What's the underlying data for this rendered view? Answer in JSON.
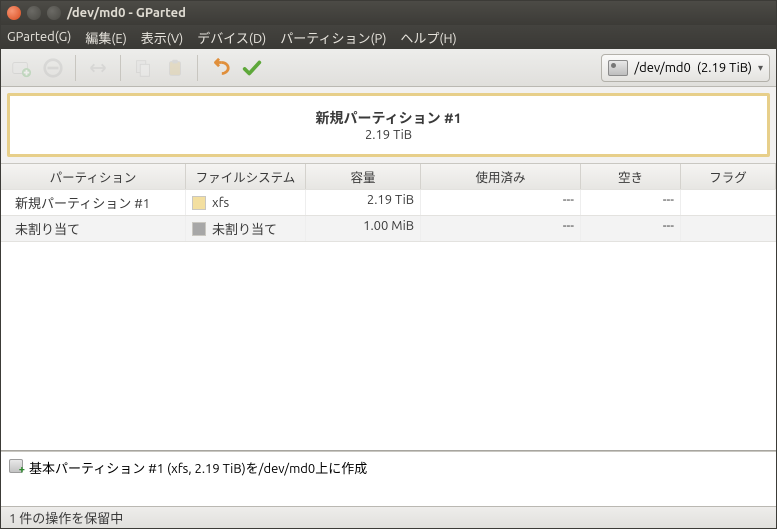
{
  "window": {
    "title": "/dev/md0 - GParted"
  },
  "menu": {
    "gparted": "GParted(G)",
    "edit": "編集(E)",
    "view": "表示(V)",
    "device": "デバイス(D)",
    "partition": "パーティション(P)",
    "help": "ヘルプ(H)"
  },
  "device_picker": {
    "path": "/dev/md0",
    "size": "(2.19 TiB)"
  },
  "visual": {
    "name": "新規パーティション #1",
    "size": "2.19 TiB"
  },
  "columns": {
    "partition": "パーティション",
    "filesystem": "ファイルシステム",
    "size": "容量",
    "used": "使用済み",
    "free": "空き",
    "flags": "フラグ"
  },
  "rows": [
    {
      "partition": "新規パーティション #1",
      "filesystem": "xfs",
      "size": "2.19 TiB",
      "used": "---",
      "free": "---",
      "flags": ""
    },
    {
      "partition": "未割り当て",
      "filesystem": "未割り当て",
      "size": "1.00 MiB",
      "used": "---",
      "free": "---",
      "flags": ""
    }
  ],
  "operation": {
    "text": "基本パーティション #1 (xfs, 2.19 TiB)を/dev/md0上に作成"
  },
  "status": {
    "text": "1 件の操作を保留中"
  }
}
